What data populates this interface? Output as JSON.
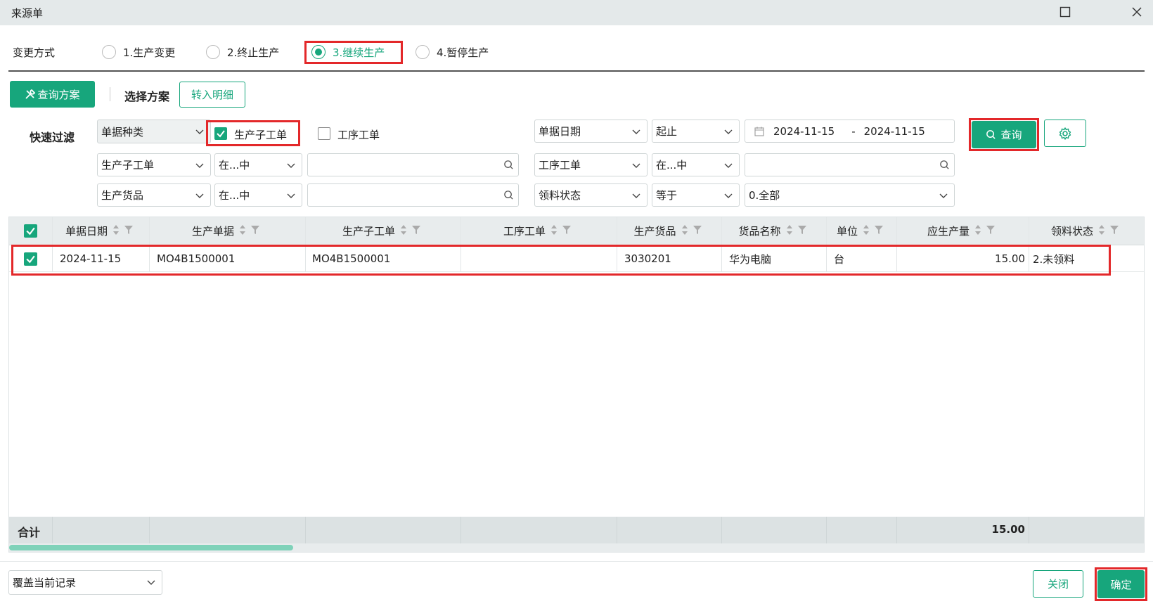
{
  "window": {
    "title": "来源单"
  },
  "change_mode": {
    "label": "变更方式",
    "options": [
      "1.生产变更",
      "2.终止生产",
      "3.继续生产",
      "4.暂停生产"
    ],
    "selected": "3.继续生产"
  },
  "toolbar": {
    "query_scheme_label": "查询方案",
    "select_scheme_label": "选择方案",
    "to_detail_label": "转入明细"
  },
  "filter": {
    "quick_filter_label": "快速过滤",
    "doc_type": "单据种类",
    "check_sub_order": {
      "label": "生产子工单",
      "checked": true
    },
    "check_process_order": {
      "label": "工序工单",
      "checked": false
    },
    "date_field": "单据日期",
    "date_op": "起止",
    "date_start": "2024-11-15",
    "date_sep": "-",
    "date_end": "2024-11-15",
    "query_label": "查询",
    "row2": {
      "field_a": "生产子工单",
      "op_a": "在...中",
      "field_b": "工序工单",
      "op_b": "在...中"
    },
    "row3": {
      "field_a": "生产货品",
      "op_a": "在...中",
      "field_b": "领料状态",
      "op_b": "等于",
      "value_b": "0.全部"
    }
  },
  "grid": {
    "columns": [
      "单据日期",
      "生产单据",
      "生产子工单",
      "工序工单",
      "生产货品",
      "货品名称",
      "单位",
      "应生产量",
      "领料状态"
    ],
    "rows": [
      [
        "2024-11-15",
        "MO4B1500001",
        "MO4B1500001",
        "",
        "3030201",
        "华为电脑",
        "台",
        "15.00",
        "2.未领料"
      ]
    ],
    "total_label": "合计",
    "total_qty": "15.00"
  },
  "bottom": {
    "mode_select": "覆盖当前记录",
    "close_label": "关闭",
    "ok_label": "确定"
  },
  "colors": {
    "accent": "#17a67c",
    "highlight": "#e3282a"
  }
}
